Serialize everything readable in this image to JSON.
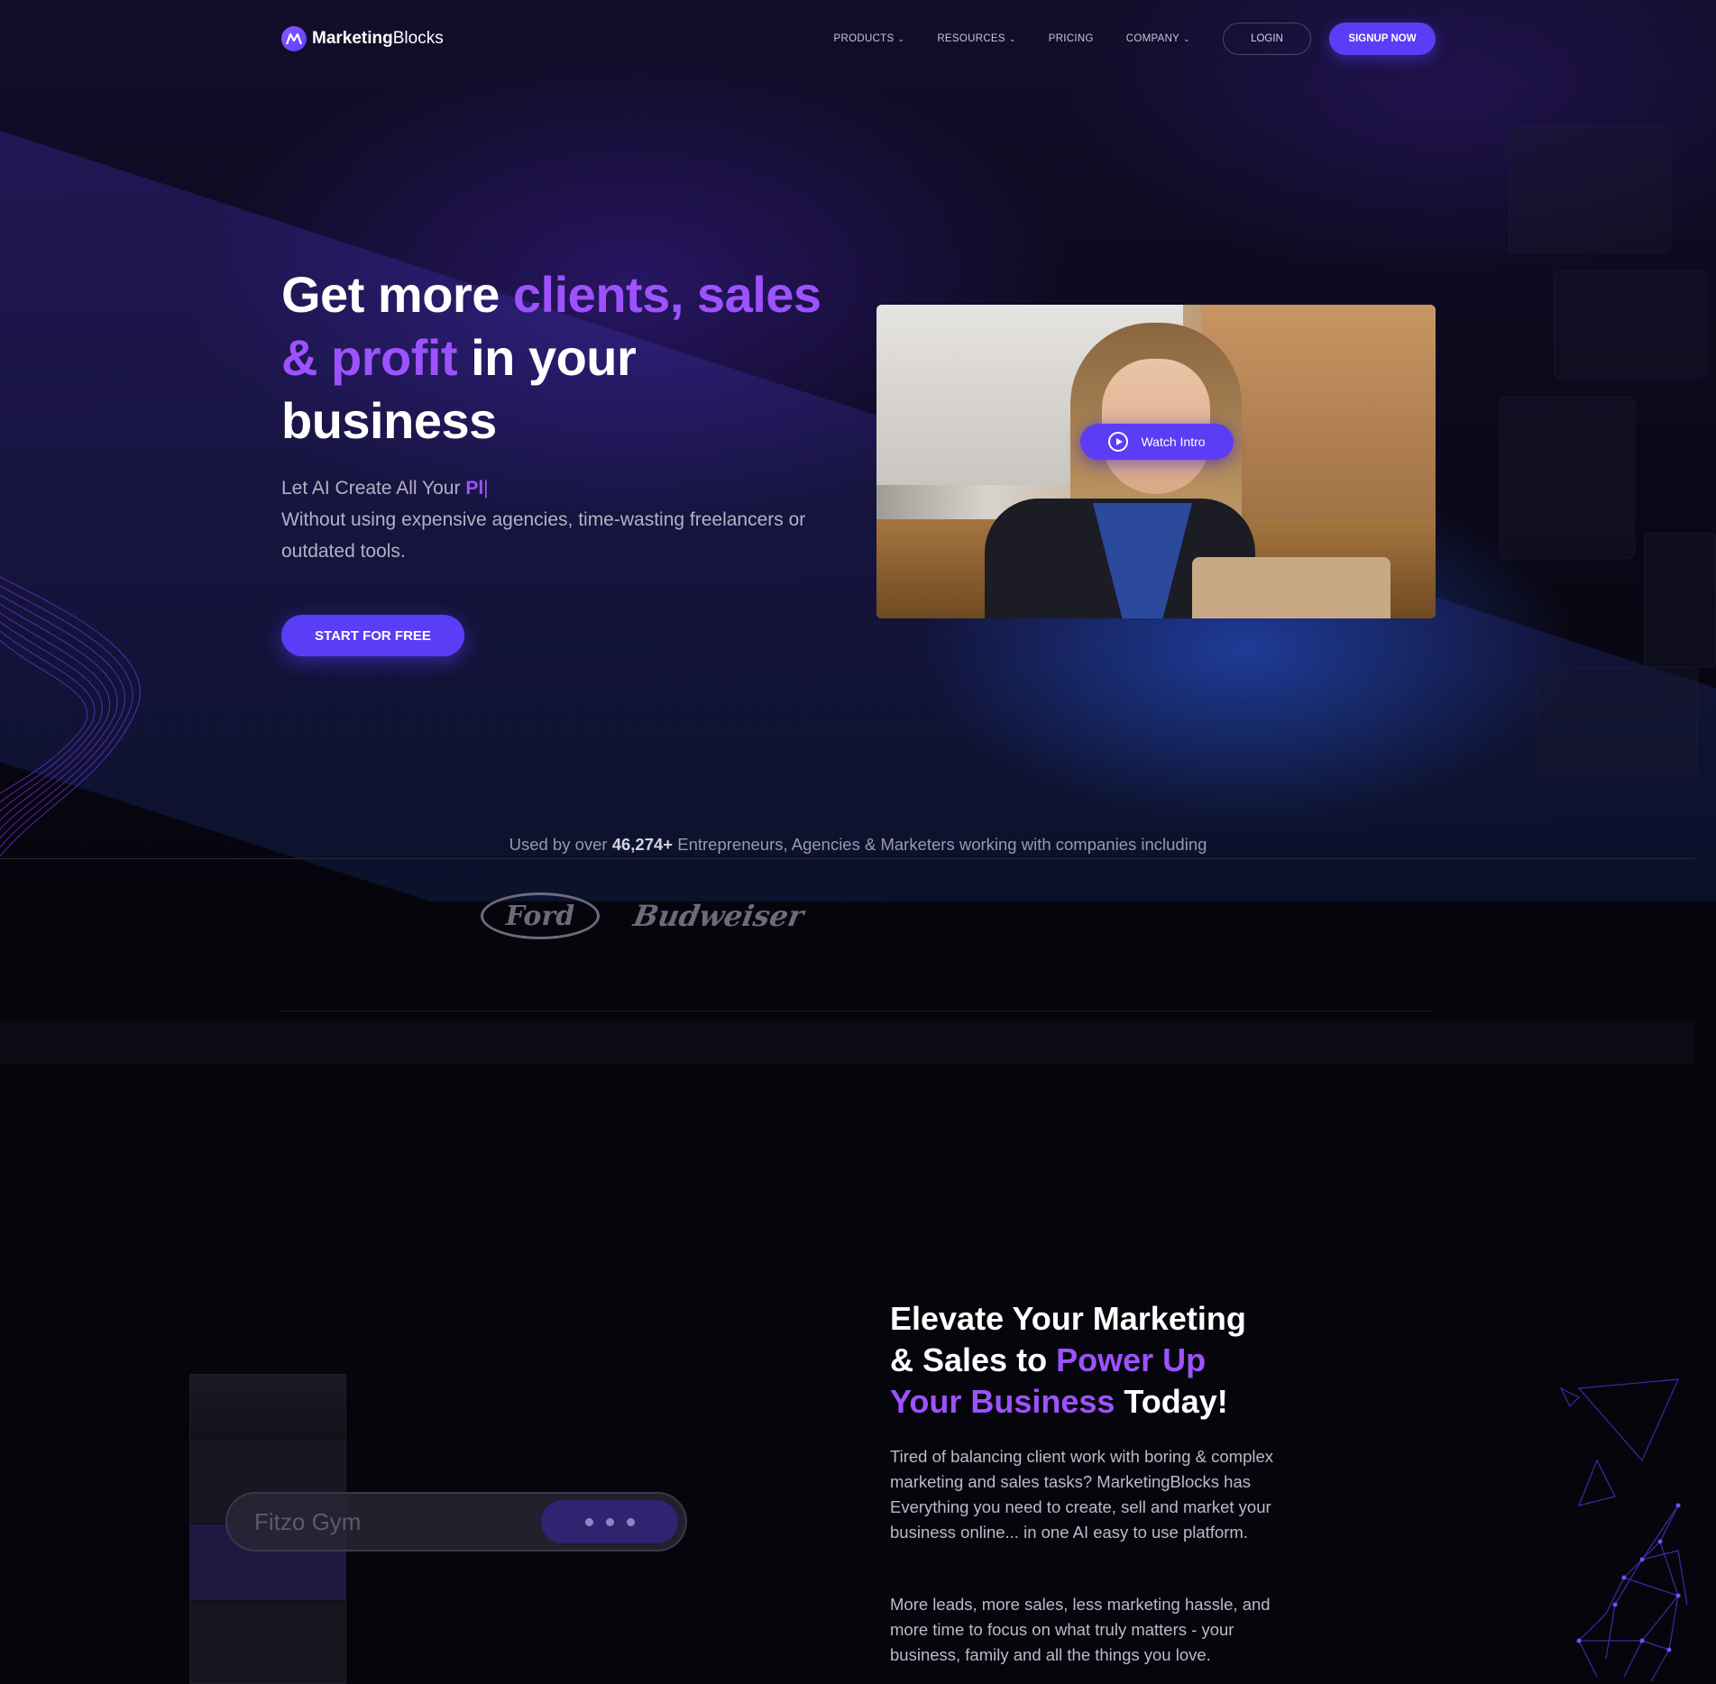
{
  "nav": {
    "logo_bold": "Marketing",
    "logo_light": "Blocks",
    "items": [
      {
        "label": "PRODUCTS",
        "has_dropdown": true
      },
      {
        "label": "RESOURCES",
        "has_dropdown": true
      },
      {
        "label": "PRICING",
        "has_dropdown": false
      },
      {
        "label": "COMPANY",
        "has_dropdown": true
      }
    ],
    "login": "LOGIN",
    "signup": "SIGNUP NOW"
  },
  "hero": {
    "title_1": "Get more ",
    "title_accent_1": "clients, sales",
    "title_accent_2": "& profit",
    "title_2": " in your",
    "title_3": "business",
    "sub_prefix": "Let AI Create All Your ",
    "sub_typed": "Pl",
    "sub_rest": "Without using expensive agencies, time-wasting freelancers or outdated tools.",
    "cta": "START FOR FREE",
    "video_button": "Watch Intro"
  },
  "trusted": {
    "prefix": "Used by over ",
    "count": "46,274+",
    "suffix": " Entrepreneurs, Agencies & Marketers working with companies including",
    "logos": [
      "Ford",
      "Budweiser"
    ]
  },
  "section2": {
    "title_1": "Elevate Your Marketing",
    "title_2": "& Sales to ",
    "title_accent_1": "Power Up",
    "title_accent_2": "Your Business",
    "title_3": " Today!",
    "p1": "Tired of balancing client work with boring & complex marketing and sales tasks?  MarketingBlocks has Everything you need to create, sell and market your business online... in one AI easy to use platform.",
    "p2": "More leads, more sales, less marketing hassle, and more time to focus on what truly matters - your business, family and all the things you love.",
    "mock_input_value": "Fitzo Gym"
  },
  "colors": {
    "accent": "#9d52ff",
    "brand_button": "#5a3df5",
    "background": "#06050c"
  }
}
